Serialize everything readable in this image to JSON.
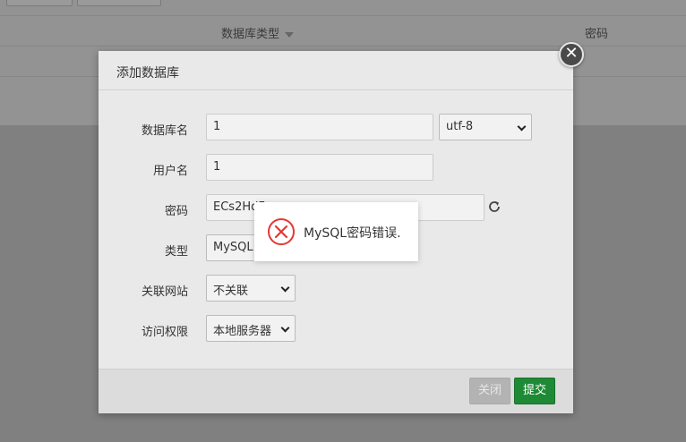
{
  "background": {
    "columns": {
      "db_type": "数据库类型",
      "password": "密码"
    }
  },
  "modal": {
    "title": "添加数据库",
    "close_symbol": "✕",
    "fields": {
      "db_name": {
        "label": "数据库名",
        "value": "1"
      },
      "charset": {
        "value": "utf-8"
      },
      "username": {
        "label": "用户名",
        "value": "1"
      },
      "password": {
        "label": "密码",
        "value": "ECs2HdF"
      },
      "type": {
        "label": "类型",
        "value": "MySQL"
      },
      "site": {
        "label": "关联网站",
        "value": "不关联"
      },
      "access": {
        "label": "访问权限",
        "value": "本地服务器"
      }
    },
    "buttons": {
      "close": "关闭",
      "submit": "提交"
    }
  },
  "toast": {
    "message": "MySQL密码错误.",
    "icon": "error-circle-x-icon",
    "icon_color": "#e53935"
  },
  "colors": {
    "accent": "#1f8a36",
    "overlay": "#808080"
  }
}
